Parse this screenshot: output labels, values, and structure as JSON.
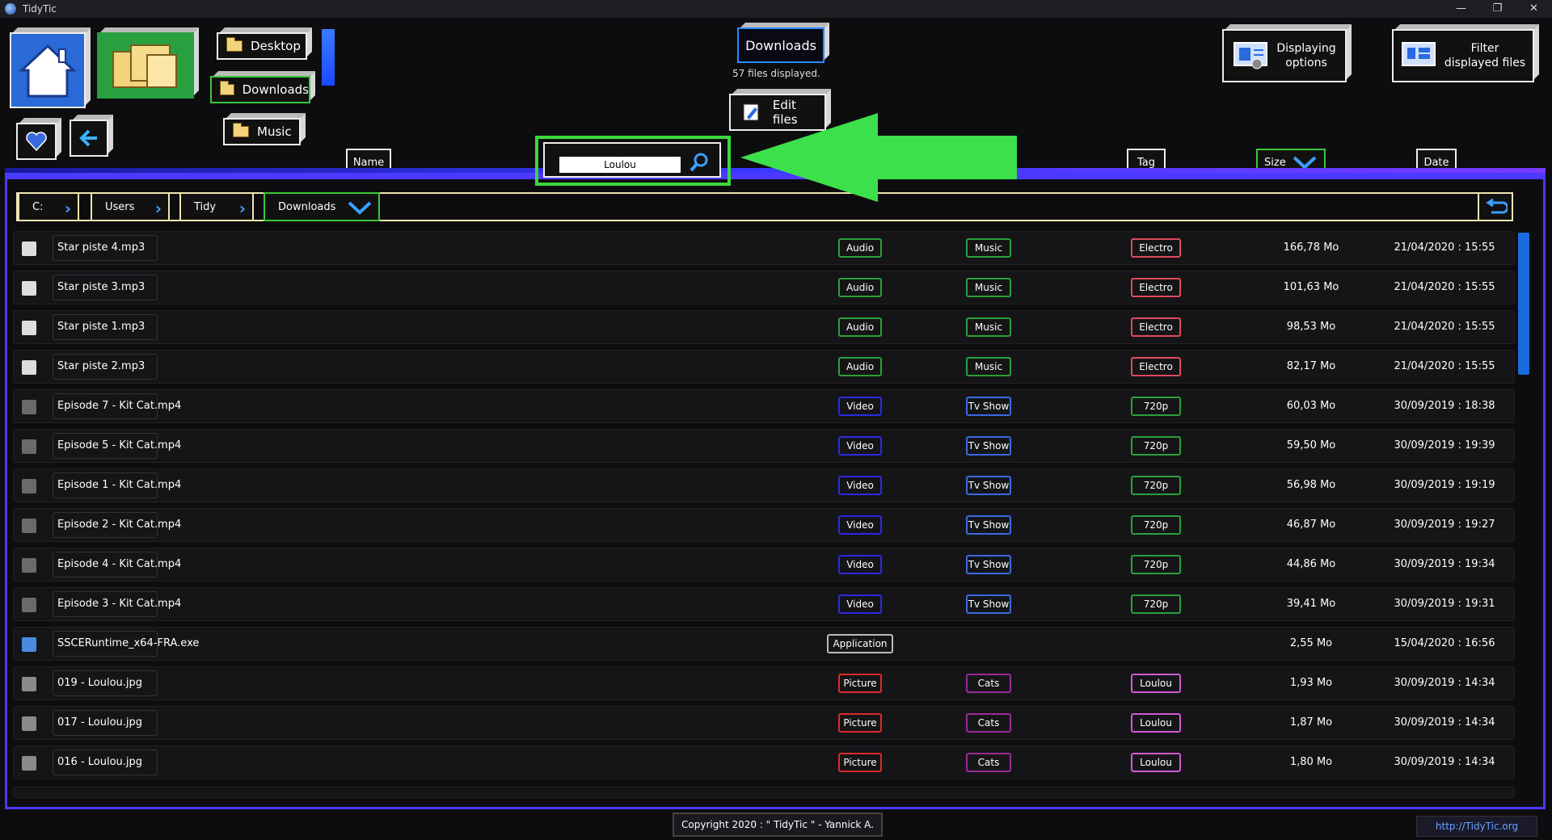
{
  "window": {
    "title": "TidyTic",
    "controls": [
      "—",
      "❐",
      "✕"
    ]
  },
  "nav": {
    "home_icon": "home-icon",
    "docs_icon": "documents-icon",
    "fav_icon": "heart-icon",
    "back_icon": "back-arrow-icon",
    "quick_folders": [
      "Desktop",
      "Downloads",
      "Music"
    ]
  },
  "center": {
    "folder_title": "Downloads",
    "files_count": "57 files displayed.",
    "edit_label": "Edit files"
  },
  "options": {
    "display_label_1": "Displaying",
    "display_label_2": "options",
    "filter_label_1": "Filter",
    "filter_label_2": "displayed files"
  },
  "search": {
    "value": "Loulou"
  },
  "columns": {
    "name": "Name",
    "tag": "Tag",
    "size": "Size",
    "date": "Date"
  },
  "breadcrumb": [
    "C:",
    "Users",
    "Tidy",
    "Downloads"
  ],
  "colors": {
    "audio": "#2aa03a",
    "music": "#2aa03a",
    "electro": "#e04a5a",
    "video": "#2a2ae0",
    "tvshow": "#3a6ae0",
    "p720": "#2aa03a",
    "application": "#bbbbbb",
    "picture": "#e02a2a",
    "cats": "#9a2a9a",
    "loulou": "#d05ad0"
  },
  "files": [
    {
      "name": "Star piste 4.mp3",
      "icon": "audio",
      "tags": [
        "Audio",
        "Music",
        "Electro"
      ],
      "size": "166,78 Mo",
      "date": "21/04/2020 : 15:55"
    },
    {
      "name": "Star piste 3.mp3",
      "icon": "audio",
      "tags": [
        "Audio",
        "Music",
        "Electro"
      ],
      "size": "101,63 Mo",
      "date": "21/04/2020 : 15:55"
    },
    {
      "name": "Star piste 1.mp3",
      "icon": "audio",
      "tags": [
        "Audio",
        "Music",
        "Electro"
      ],
      "size": "98,53 Mo",
      "date": "21/04/2020 : 15:55"
    },
    {
      "name": "Star piste 2.mp3",
      "icon": "audio",
      "tags": [
        "Audio",
        "Music",
        "Electro"
      ],
      "size": "82,17 Mo",
      "date": "21/04/2020 : 15:55"
    },
    {
      "name": "Episode 7 - Kit Cat.mp4",
      "icon": "video",
      "tags": [
        "Video",
        "Tv Show",
        "720p"
      ],
      "size": "60,03 Mo",
      "date": "30/09/2019 : 18:38"
    },
    {
      "name": "Episode 5 - Kit Cat.mp4",
      "icon": "video",
      "tags": [
        "Video",
        "Tv Show",
        "720p"
      ],
      "size": "59,50 Mo",
      "date": "30/09/2019 : 19:39"
    },
    {
      "name": "Episode 1 - Kit Cat.mp4",
      "icon": "video",
      "tags": [
        "Video",
        "Tv Show",
        "720p"
      ],
      "size": "56,98 Mo",
      "date": "30/09/2019 : 19:19"
    },
    {
      "name": "Episode 2 - Kit Cat.mp4",
      "icon": "video",
      "tags": [
        "Video",
        "Tv Show",
        "720p"
      ],
      "size": "46,87 Mo",
      "date": "30/09/2019 : 19:27"
    },
    {
      "name": "Episode 4 - Kit Cat.mp4",
      "icon": "video",
      "tags": [
        "Video",
        "Tv Show",
        "720p"
      ],
      "size": "44,86 Mo",
      "date": "30/09/2019 : 19:34"
    },
    {
      "name": "Episode 3 - Kit Cat.mp4",
      "icon": "video",
      "tags": [
        "Video",
        "Tv Show",
        "720p"
      ],
      "size": "39,41 Mo",
      "date": "30/09/2019 : 19:31"
    },
    {
      "name": "SSCERuntime_x64-FRA.exe",
      "icon": "exe",
      "tags": [
        "Application"
      ],
      "size": "2,55 Mo",
      "date": "15/04/2020 : 16:56"
    },
    {
      "name": "019 - Loulou.jpg",
      "icon": "pic",
      "tags": [
        "Picture",
        "Cats",
        "Loulou"
      ],
      "size": "1,93 Mo",
      "date": "30/09/2019 : 14:34"
    },
    {
      "name": "017 - Loulou.jpg",
      "icon": "pic",
      "tags": [
        "Picture",
        "Cats",
        "Loulou"
      ],
      "size": "1,87 Mo",
      "date": "30/09/2019 : 14:34"
    },
    {
      "name": "016 - Loulou.jpg",
      "icon": "pic",
      "tags": [
        "Picture",
        "Cats",
        "Loulou"
      ],
      "size": "1,80 Mo",
      "date": "30/09/2019 : 14:34"
    }
  ],
  "footer": {
    "copyright": "Copyright 2020 : \" TidyTic \" - Yannick A.",
    "url": "http://TidyTic.org"
  }
}
